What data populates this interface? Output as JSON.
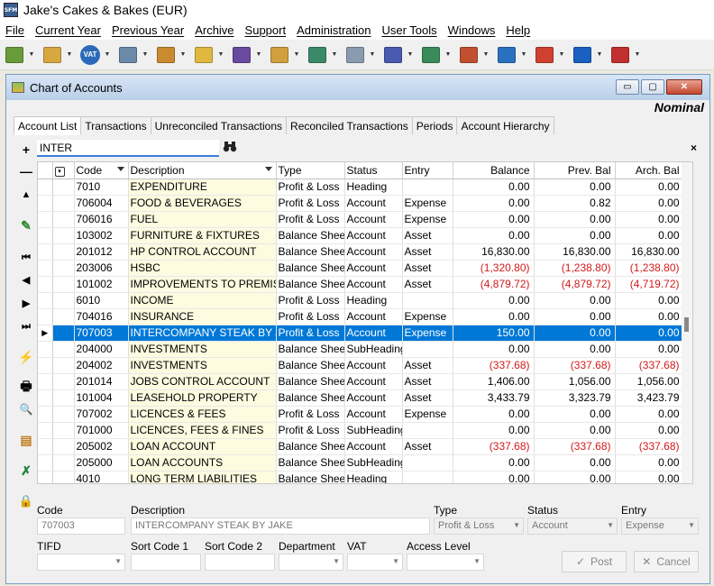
{
  "app": {
    "title": "Jake's Cakes & Bakes (EUR)",
    "icon_text": "SFM"
  },
  "menu": [
    "File",
    "Current Year",
    "Previous Year",
    "Archive",
    "Support",
    "Administration",
    "User Tools",
    "Windows",
    "Help"
  ],
  "toolbar": {
    "vat_label": "VAT",
    "colors": [
      "#6a9b3a",
      "#d8a840",
      "#2a6ab8",
      "#6a8aa8",
      "#c98a30",
      "#e0b840",
      "#6a4aa0",
      "#d0a040",
      "#3a8a6a",
      "#8a9ab0",
      "#4a5ab0",
      "#3a8a5a",
      "#c05030",
      "#2a70c0",
      "#d04030",
      "#1a60c0",
      "#c03030"
    ]
  },
  "window": {
    "title": "Chart of Accounts",
    "subtitle": "Nominal",
    "min_label": "▭",
    "max_label": "▢",
    "close_label": "✕"
  },
  "tabs": [
    "Account List",
    "Transactions",
    "Unreconciled Transactions",
    "Reconciled Transactions",
    "Periods",
    "Account Hierarchy"
  ],
  "search": {
    "value": "INTER",
    "search_icon": "binoculars-icon",
    "clear_label": "×"
  },
  "sidebar": {
    "add": "+",
    "remove": "—",
    "up": "▲",
    "edit": "✎",
    "first": "⏮",
    "prev": "◀",
    "next": "▶",
    "last": "⏭",
    "filter": "⚡",
    "print": "🖶",
    "attach": "🔍",
    "report": "▤",
    "export": "✗",
    "lock": "🔒"
  },
  "columns": {
    "chooser": "▾",
    "code": "Code",
    "description": "Description",
    "type": "Type",
    "status": "Status",
    "entry": "Entry",
    "balance": "Balance",
    "prev_bal": "Prev. Bal",
    "arch_bal": "Arch. Bal"
  },
  "rows": [
    {
      "code": "7010",
      "description": "EXPENDITURE",
      "type": "Profit & Loss",
      "status": "Heading",
      "entry": "",
      "balance": "0.00",
      "prev_bal": "0.00",
      "arch_bal": "0.00"
    },
    {
      "code": "706004",
      "description": "FOOD & BEVERAGES",
      "type": "Profit & Loss",
      "status": "Account",
      "entry": "Expense",
      "balance": "0.00",
      "prev_bal": "0.82",
      "arch_bal": "0.00"
    },
    {
      "code": "706016",
      "description": "FUEL",
      "type": "Profit & Loss",
      "status": "Account",
      "entry": "Expense",
      "balance": "0.00",
      "prev_bal": "0.00",
      "arch_bal": "0.00"
    },
    {
      "code": "103002",
      "description": "FURNITURE & FIXTURES",
      "type": "Balance Sheet",
      "status": "Account",
      "entry": "Asset",
      "balance": "0.00",
      "prev_bal": "0.00",
      "arch_bal": "0.00"
    },
    {
      "code": "201012",
      "description": "HP CONTROL ACCOUNT",
      "type": "Balance Sheet",
      "status": "Account",
      "entry": "Asset",
      "balance": "16,830.00",
      "prev_bal": "16,830.00",
      "arch_bal": "16,830.00"
    },
    {
      "code": "203006",
      "description": "HSBC",
      "type": "Balance Sheet",
      "status": "Account",
      "entry": "Asset",
      "balance": "(1,320.80)",
      "prev_bal": "(1,238.80)",
      "arch_bal": "(1,238.80)"
    },
    {
      "code": "101002",
      "description": "IMPROVEMENTS TO PREMISES",
      "type": "Balance Sheet",
      "status": "Account",
      "entry": "Asset",
      "balance": "(4,879.72)",
      "prev_bal": "(4,879.72)",
      "arch_bal": "(4,719.72)"
    },
    {
      "code": "6010",
      "description": "INCOME",
      "type": "Profit & Loss",
      "status": "Heading",
      "entry": "",
      "balance": "0.00",
      "prev_bal": "0.00",
      "arch_bal": "0.00"
    },
    {
      "code": "704016",
      "description": "INSURANCE",
      "type": "Profit & Loss",
      "status": "Account",
      "entry": "Expense",
      "balance": "0.00",
      "prev_bal": "0.00",
      "arch_bal": "0.00"
    },
    {
      "code": "707003",
      "description": "INTERCOMPANY STEAK BY JAKE",
      "type": "Profit & Loss",
      "status": "Account",
      "entry": "Expense",
      "balance": "150.00",
      "prev_bal": "0.00",
      "arch_bal": "0.00",
      "selected": true
    },
    {
      "code": "204000",
      "description": "INVESTMENTS",
      "type": "Balance Sheet",
      "status": "SubHeading",
      "entry": "",
      "balance": "0.00",
      "prev_bal": "0.00",
      "arch_bal": "0.00"
    },
    {
      "code": "204002",
      "description": "INVESTMENTS",
      "type": "Balance Sheet",
      "status": "Account",
      "entry": "Asset",
      "balance": "(337.68)",
      "prev_bal": "(337.68)",
      "arch_bal": "(337.68)"
    },
    {
      "code": "201014",
      "description": "JOBS CONTROL ACCOUNT",
      "type": "Balance Sheet",
      "status": "Account",
      "entry": "Asset",
      "balance": "1,406.00",
      "prev_bal": "1,056.00",
      "arch_bal": "1,056.00"
    },
    {
      "code": "101004",
      "description": "LEASEHOLD PROPERTY",
      "type": "Balance Sheet",
      "status": "Account",
      "entry": "Asset",
      "balance": "3,433.79",
      "prev_bal": "3,323.79",
      "arch_bal": "3,423.79"
    },
    {
      "code": "707002",
      "description": "LICENCES & FEES",
      "type": "Profit & Loss",
      "status": "Account",
      "entry": "Expense",
      "balance": "0.00",
      "prev_bal": "0.00",
      "arch_bal": "0.00"
    },
    {
      "code": "701000",
      "description": "LICENCES, FEES & FINES",
      "type": "Profit & Loss",
      "status": "SubHeading",
      "entry": "",
      "balance": "0.00",
      "prev_bal": "0.00",
      "arch_bal": "0.00"
    },
    {
      "code": "205002",
      "description": "LOAN ACCOUNT",
      "type": "Balance Sheet",
      "status": "Account",
      "entry": "Asset",
      "balance": "(337.68)",
      "prev_bal": "(337.68)",
      "arch_bal": "(337.68)"
    },
    {
      "code": "205000",
      "description": "LOAN ACCOUNTS",
      "type": "Balance Sheet",
      "status": "SubHeading",
      "entry": "",
      "balance": "0.00",
      "prev_bal": "0.00",
      "arch_bal": "0.00"
    },
    {
      "code": "4010",
      "description": "LONG TERM LIABILITIES",
      "type": "Balance Sheet",
      "status": "Heading",
      "entry": "",
      "balance": "0.00",
      "prev_bal": "0.00",
      "arch_bal": "0.00"
    }
  ],
  "form": {
    "code_label": "Code",
    "code_value": "707003",
    "desc_label": "Description",
    "desc_value": "INTERCOMPANY STEAK BY JAKE",
    "type_label": "Type",
    "type_value": "Profit & Loss",
    "status_label": "Status",
    "status_value": "Account",
    "entry_label": "Entry",
    "entry_value": "Expense",
    "tifd_label": "TIFD",
    "sort1_label": "Sort Code 1",
    "sort2_label": "Sort Code 2",
    "dept_label": "Department",
    "vat_label": "VAT",
    "access_label": "Access Level",
    "post_label": "Post",
    "cancel_label": "Cancel"
  },
  "colors": {
    "selected_row": "#0078d7",
    "negative": "#d21a1a",
    "description_bg": "#fdfbe0"
  }
}
